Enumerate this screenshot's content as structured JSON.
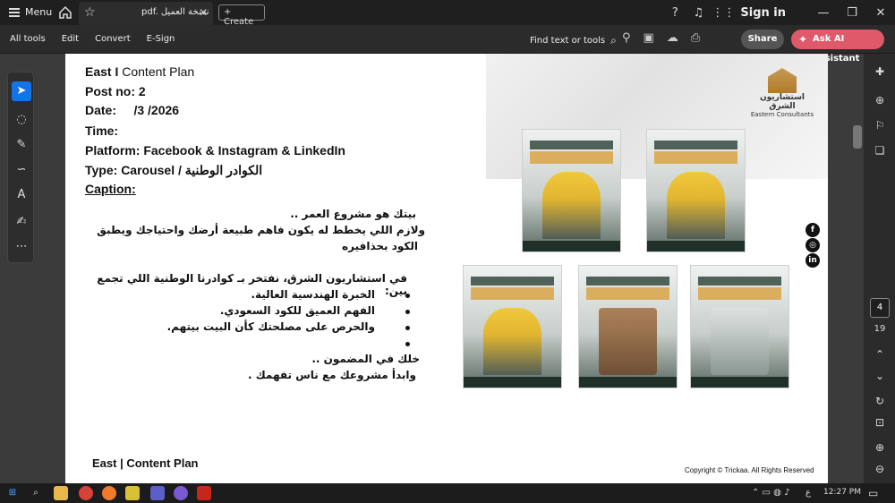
{
  "titlebar": {
    "menu_label": "Menu",
    "tab_name": "pdf. نسخة العميل",
    "create_label": "Create",
    "signin_label": "Sign in"
  },
  "toolbar": {
    "menus": [
      "All tools",
      "Edit",
      "Convert",
      "E-Sign"
    ],
    "find_label": "Find text or tools",
    "share_label": "Share",
    "ask_ai_label": "Ask AI Assistant"
  },
  "document": {
    "header_line1_bold": "East I",
    "header_line1_rest": " Content Plan",
    "post_no": "Post no: 2",
    "date": "Date:     /3 /2026",
    "time": "Time:",
    "platform": "Platform: Facebook & Instagram & LinkedIn",
    "type": "Type: Carousel / الكوادر الوطنية",
    "caption_label": "Caption:",
    "arabic_lines": [
      "بيتك هو مشروع العمر ..",
      "ولازم اللي يخطط له يكون فاهم طبيعة أرضك واحتياجك ويطبق",
      "الكود بحذافيره",
      "في استشاريون الشرق، نفتخر بـ كوادرنا الوطنية اللي تجمع بين:",
      "الخبرة الهندسية العالية.",
      "الفهم العميق للكود السعودي.",
      "والحرص على مصلحتك كأن البيت بيتهم.",
      "خلك في المضمون ..",
      "وابدأ مشروعك مع ناس تفهمك ."
    ],
    "logo_ar": "استشاريون الشرق",
    "logo_en": "Eastern Consultants",
    "footer_left": "East | Content Plan",
    "footer_right": "Copyright © Trickaa. All Rights Reserved",
    "social_icons": [
      "facebook-icon",
      "instagram-icon",
      "linkedin-icon"
    ]
  },
  "navigation": {
    "current_page": "4",
    "total_pages": "19"
  },
  "taskbar": {
    "time": "12:27 PM",
    "lang": "ع"
  }
}
